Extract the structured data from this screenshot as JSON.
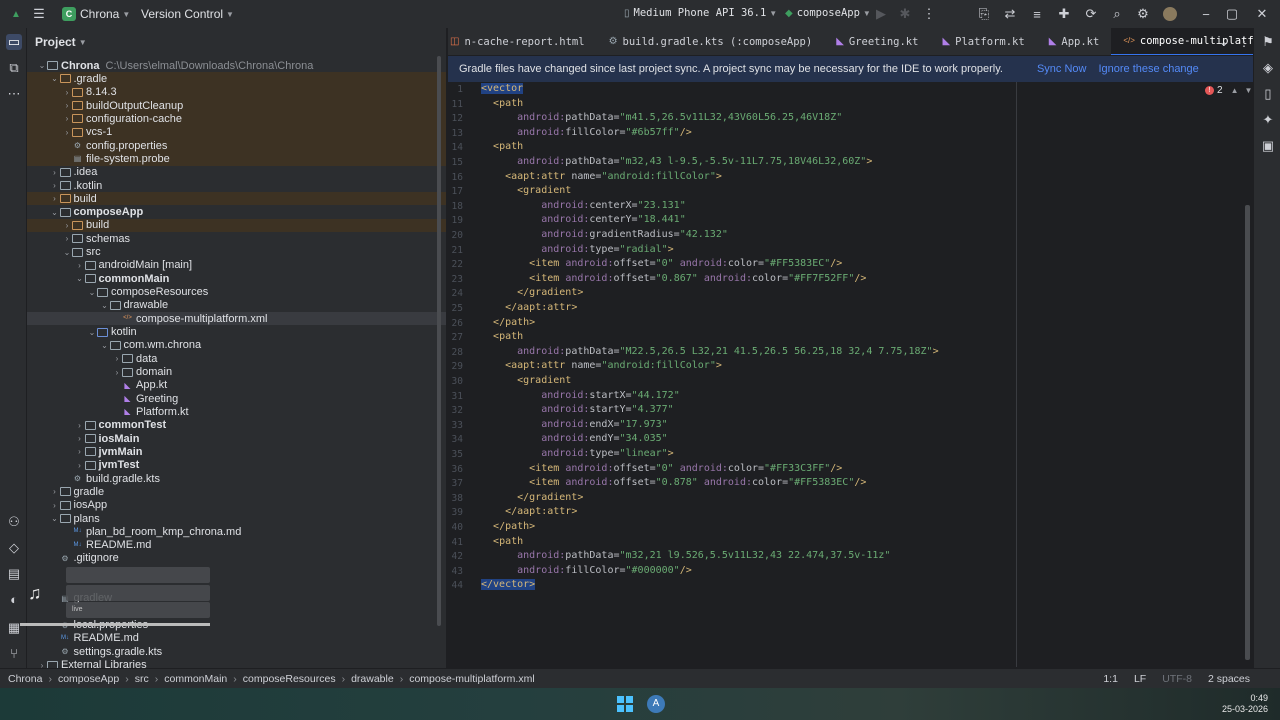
{
  "titlebar": {
    "project_badge": "C",
    "project_name": "Chrona",
    "vcs": "Version Control",
    "device": "Medium Phone API 36.1",
    "run_config": "composeApp"
  },
  "project_panel": {
    "title": "Project",
    "rows": [
      {
        "indent": 0,
        "label": "Chrona",
        "extra": "C:\\Users\\elmal\\Downloads\\Chrona\\Chrona",
        "type": "folder",
        "open": true,
        "bold": true
      },
      {
        "indent": 1,
        "label": ".gradle",
        "type": "folder-o",
        "open": true,
        "excluded": true
      },
      {
        "indent": 2,
        "label": "8.14.3",
        "type": "folder-o",
        "open": false,
        "excluded": true
      },
      {
        "indent": 2,
        "label": "buildOutputCleanup",
        "type": "folder-o",
        "open": false,
        "excluded": true
      },
      {
        "indent": 2,
        "label": "configuration-cache",
        "type": "folder-o",
        "open": false,
        "excluded": true
      },
      {
        "indent": 2,
        "label": "vcs-1",
        "type": "folder-o",
        "open": false,
        "excluded": true
      },
      {
        "indent": 2,
        "label": "config.properties",
        "type": "gear",
        "excluded": true
      },
      {
        "indent": 2,
        "label": "file-system.probe",
        "type": "file",
        "excluded": true
      },
      {
        "indent": 1,
        "label": ".idea",
        "type": "folder",
        "open": false
      },
      {
        "indent": 1,
        "label": ".kotlin",
        "type": "folder",
        "open": false
      },
      {
        "indent": 1,
        "label": "build",
        "type": "folder-o",
        "open": false,
        "excluded": true
      },
      {
        "indent": 1,
        "label": "composeApp",
        "type": "folder",
        "open": true,
        "bold": true
      },
      {
        "indent": 2,
        "label": "build",
        "type": "folder-o",
        "open": false,
        "excluded": true
      },
      {
        "indent": 2,
        "label": "schemas",
        "type": "folder",
        "open": false
      },
      {
        "indent": 2,
        "label": "src",
        "type": "folder",
        "open": true
      },
      {
        "indent": 3,
        "label": "androidMain [main]",
        "type": "folder",
        "open": false,
        "bold": false
      },
      {
        "indent": 3,
        "label": "commonMain",
        "type": "folder",
        "open": true,
        "bold": true
      },
      {
        "indent": 4,
        "label": "composeResources",
        "type": "folder",
        "open": true
      },
      {
        "indent": 5,
        "label": "drawable",
        "type": "folder",
        "open": true
      },
      {
        "indent": 6,
        "label": "compose-multiplatform.xml",
        "type": "xml",
        "hl": true
      },
      {
        "indent": 4,
        "label": "kotlin",
        "type": "folder-b",
        "open": true
      },
      {
        "indent": 5,
        "label": "com.wm.chrona",
        "type": "folder",
        "open": true
      },
      {
        "indent": 6,
        "label": "data",
        "type": "folder",
        "open": false
      },
      {
        "indent": 6,
        "label": "domain",
        "type": "folder",
        "open": false
      },
      {
        "indent": 6,
        "label": "App.kt",
        "type": "kt"
      },
      {
        "indent": 6,
        "label": "Greeting",
        "type": "kt"
      },
      {
        "indent": 6,
        "label": "Platform.kt",
        "type": "kt"
      },
      {
        "indent": 3,
        "label": "commonTest",
        "type": "folder",
        "open": false,
        "bold": true
      },
      {
        "indent": 3,
        "label": "iosMain",
        "type": "folder",
        "open": false,
        "bold": true
      },
      {
        "indent": 3,
        "label": "jvmMain",
        "type": "folder",
        "open": false,
        "bold": true
      },
      {
        "indent": 3,
        "label": "jvmTest",
        "type": "folder",
        "open": false,
        "bold": true
      },
      {
        "indent": 2,
        "label": "build.gradle.kts",
        "type": "gear"
      },
      {
        "indent": 1,
        "label": "gradle",
        "type": "folder",
        "open": false
      },
      {
        "indent": 1,
        "label": "iosApp",
        "type": "folder",
        "open": false
      },
      {
        "indent": 1,
        "label": "plans",
        "type": "folder",
        "open": true
      },
      {
        "indent": 2,
        "label": "plan_bd_room_kmp_chrona.md",
        "type": "md"
      },
      {
        "indent": 2,
        "label": "README.md",
        "type": "md"
      },
      {
        "indent": 1,
        "label": ".gitignore",
        "type": "gear"
      },
      {
        "indent": 1,
        "label": "",
        "type": "blank"
      },
      {
        "indent": 1,
        "label": "",
        "type": "blank"
      },
      {
        "indent": 1,
        "label": "gradlew",
        "type": "file"
      },
      {
        "indent": 1,
        "label": "",
        "type": "blank"
      },
      {
        "indent": 1,
        "label": "local.properties",
        "type": "gear"
      },
      {
        "indent": 1,
        "label": "README.md",
        "type": "md"
      },
      {
        "indent": 1,
        "label": "settings.gradle.kts",
        "type": "gear"
      },
      {
        "indent": 0,
        "label": "External Libraries",
        "type": "folder",
        "open": false
      }
    ]
  },
  "tabs": [
    {
      "label": "n-cache-report.html",
      "icon": "html"
    },
    {
      "label": "build.gradle.kts (:composeApp)",
      "icon": "gear"
    },
    {
      "label": "Greeting.kt",
      "icon": "kt"
    },
    {
      "label": "Platform.kt",
      "icon": "kt"
    },
    {
      "label": "App.kt",
      "icon": "kt"
    },
    {
      "label": "compose-multiplatform.xml",
      "icon": "xml",
      "active": true
    }
  ],
  "banner": {
    "message": "Gradle files have changed since last project sync. A project sync may be necessary for the IDE to work properly.",
    "sync": "Sync Now",
    "ignore": "Ignore these change"
  },
  "errors": "2",
  "code_lines": [
    {
      "n": "1",
      "html": "<span class='sel-tag'>&lt;vector</span>"
    },
    {
      "n": "11",
      "html": "  <span class='tag'>&lt;path</span>"
    },
    {
      "n": "12",
      "html": "      <span class='ns'>android:</span><span class='attr'>pathData=</span><span class='val'>\"m41.5,26.5v11L32,43V60L56.25,46V18Z\"</span>"
    },
    {
      "n": "13",
      "html": "      <span class='ns'>android:</span><span class='attr'>fillColor=</span><span class='val'>\"#6b57ff\"</span><span class='tag'>/&gt;</span>"
    },
    {
      "n": "14",
      "html": "  <span class='tag'>&lt;path</span>"
    },
    {
      "n": "15",
      "html": "      <span class='ns'>android:</span><span class='attr'>pathData=</span><span class='val'>\"m32,43 l-9.5,-5.5v-11L7.75,18V46L32,60Z\"</span><span class='tag'>&gt;</span>"
    },
    {
      "n": "16",
      "html": "    <span class='tag'>&lt;aapt:attr</span> <span class='attr'>name=</span><span class='val'>\"android:fillColor\"</span><span class='tag'>&gt;</span>"
    },
    {
      "n": "17",
      "html": "      <span class='tag'>&lt;gradient</span>"
    },
    {
      "n": "18",
      "html": "          <span class='ns'>android:</span><span class='attr'>centerX=</span><span class='val'>\"23.131\"</span>"
    },
    {
      "n": "19",
      "html": "          <span class='ns'>android:</span><span class='attr'>centerY=</span><span class='val'>\"18.441\"</span>"
    },
    {
      "n": "20",
      "html": "          <span class='ns'>android:</span><span class='attr'>gradientRadius=</span><span class='val'>\"42.132\"</span>"
    },
    {
      "n": "21",
      "html": "          <span class='ns'>android:</span><span class='attr'>type=</span><span class='val'>\"radial\"</span><span class='tag'>&gt;</span>"
    },
    {
      "n": "22",
      "html": "        <span class='tag'>&lt;item</span> <span class='ns'>android:</span><span class='attr'>offset=</span><span class='val'>\"0\"</span> <span class='ns'>android:</span><span class='attr'>color=</span><span class='val'>\"#FF5383EC\"</span><span class='tag'>/&gt;</span>"
    },
    {
      "n": "23",
      "html": "        <span class='tag'>&lt;item</span> <span class='ns'>android:</span><span class='attr'>offset=</span><span class='val'>\"0.867\"</span> <span class='ns'>android:</span><span class='attr'>color=</span><span class='val'>\"#FF7F52FF\"</span><span class='tag'>/&gt;</span>"
    },
    {
      "n": "24",
      "html": "      <span class='tag'>&lt;/gradient&gt;</span>"
    },
    {
      "n": "25",
      "html": "    <span class='tag'>&lt;/aapt:attr&gt;</span>"
    },
    {
      "n": "26",
      "html": "  <span class='tag'>&lt;/path&gt;</span>"
    },
    {
      "n": "27",
      "html": "  <span class='tag'>&lt;path</span>"
    },
    {
      "n": "28",
      "html": "      <span class='ns'>android:</span><span class='attr'>pathData=</span><span class='val'>\"M22.5,26.5 L32,21 41.5,26.5 56.25,18 32,4 7.75,18Z\"</span><span class='tag'>&gt;</span>"
    },
    {
      "n": "29",
      "html": "    <span class='tag'>&lt;aapt:attr</span> <span class='attr'>name=</span><span class='val'>\"android:fillColor\"</span><span class='tag'>&gt;</span>"
    },
    {
      "n": "30",
      "html": "      <span class='tag'>&lt;gradient</span>"
    },
    {
      "n": "31",
      "html": "          <span class='ns'>android:</span><span class='attr'>startX=</span><span class='val'>\"44.172\"</span>"
    },
    {
      "n": "32",
      "html": "          <span class='ns'>android:</span><span class='attr'>startY=</span><span class='val'>\"4.377\"</span>"
    },
    {
      "n": "33",
      "html": "          <span class='ns'>android:</span><span class='attr'>endX=</span><span class='val'>\"17.973\"</span>"
    },
    {
      "n": "34",
      "html": "          <span class='ns'>android:</span><span class='attr'>endY=</span><span class='val'>\"34.035\"</span>"
    },
    {
      "n": "35",
      "html": "          <span class='ns'>android:</span><span class='attr'>type=</span><span class='val'>\"linear\"</span><span class='tag'>&gt;</span>"
    },
    {
      "n": "36",
      "html": "        <span class='tag'>&lt;item</span> <span class='ns'>android:</span><span class='attr'>offset=</span><span class='val'>\"0\"</span> <span class='ns'>android:</span><span class='attr'>color=</span><span class='val'>\"#FF33C3FF\"</span><span class='tag'>/&gt;</span>"
    },
    {
      "n": "37",
      "html": "        <span class='tag'>&lt;item</span> <span class='ns'>android:</span><span class='attr'>offset=</span><span class='val'>\"0.878\"</span> <span class='ns'>android:</span><span class='attr'>color=</span><span class='val'>\"#FF5383EC\"</span><span class='tag'>/&gt;</span>"
    },
    {
      "n": "38",
      "html": "      <span class='tag'>&lt;/gradient&gt;</span>"
    },
    {
      "n": "39",
      "html": "    <span class='tag'>&lt;/aapt:attr&gt;</span>"
    },
    {
      "n": "40",
      "html": "  <span class='tag'>&lt;/path&gt;</span>"
    },
    {
      "n": "41",
      "html": "  <span class='tag'>&lt;path</span>"
    },
    {
      "n": "42",
      "html": "      <span class='ns'>android:</span><span class='attr'>pathData=</span><span class='val'>\"m32,21 l9.526,5.5v11L32,43 22.474,37.5v-11z\"</span>"
    },
    {
      "n": "43",
      "html": "      <span class='ns'>android:</span><span class='attr'>fillColor=</span><span class='val'>\"#000000\"</span><span class='tag'>/&gt;</span>"
    },
    {
      "n": "44",
      "html": "<span class='sel-tag'>&lt;/vector&gt;</span>"
    }
  ],
  "breadcrumb": [
    "Chrona",
    "composeApp",
    "src",
    "commonMain",
    "composeResources",
    "drawable",
    "compose-multiplatform.xml"
  ],
  "status": {
    "position": "1:1",
    "line_sep": "LF",
    "encoding": "UTF-8",
    "indent": "2 spaces"
  },
  "media": {
    "live": "live"
  },
  "clock": {
    "time": "0:49",
    "date": "25-03-2026"
  }
}
